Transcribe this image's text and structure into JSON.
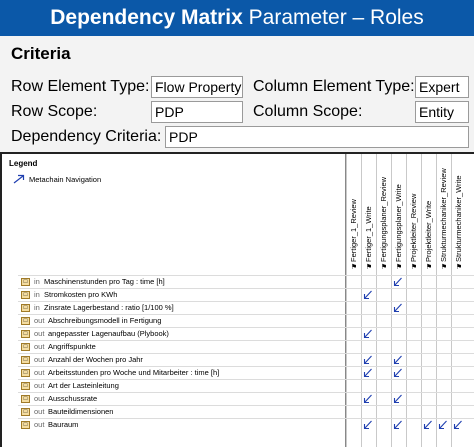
{
  "title": {
    "bold": "Dependency Matrix",
    "rest": " Parameter – Roles"
  },
  "criteria": {
    "heading": "Criteria",
    "row_element_type_label": "Row Element Type:",
    "row_element_type_value": "Flow Property",
    "column_element_type_label": "Column Element Type:",
    "column_element_type_value": "Expert",
    "row_scope_label": "Row Scope:",
    "row_scope_value": "PDP",
    "column_scope_label": "Column Scope:",
    "column_scope_value": "Entity",
    "dependency_criteria_label": "Dependency Criteria:",
    "dependency_criteria_value": "PDP"
  },
  "legend": {
    "title": "Legend",
    "item": "Metachain Navigation"
  },
  "columns": [
    "Fertiger_1_Review",
    "Fertiger_1_Write",
    "Fertigungsplaner_Review",
    "Fertigungsplaner_Write",
    "Projektleiter_Review",
    "Projektleiter_Write",
    "Strukturmechaniker_Review",
    "Strukturmechaniker_Write"
  ],
  "rows": [
    {
      "dir": "in",
      "name": "Maschinenstunden pro Tag : time [h]",
      "marks": [
        3
      ]
    },
    {
      "dir": "in",
      "name": "Stromkosten pro KWh",
      "marks": [
        1
      ]
    },
    {
      "dir": "in",
      "name": "Zinsrate Lagerbestand : ratio [1/100 %]",
      "marks": [
        3
      ]
    },
    {
      "dir": "out",
      "name": "Abschreibungsmodell in Fertigung",
      "marks": []
    },
    {
      "dir": "out",
      "name": "angepasster Lagenaufbau (Plybook)",
      "marks": [
        1
      ]
    },
    {
      "dir": "out",
      "name": "Angriffspunkte",
      "marks": []
    },
    {
      "dir": "out",
      "name": "Anzahl der Wochen pro Jahr",
      "marks": [
        1,
        3
      ]
    },
    {
      "dir": "out",
      "name": "Arbeitsstunden pro Woche und Mitarbeiter : time [h]",
      "marks": [
        1,
        3
      ]
    },
    {
      "dir": "out",
      "name": "Art der Lasteinleitung",
      "marks": []
    },
    {
      "dir": "out",
      "name": "Ausschussrate",
      "marks": [
        1,
        3
      ]
    },
    {
      "dir": "out",
      "name": "Bauteildimensionen",
      "marks": []
    },
    {
      "dir": "out",
      "name": "Bauraum",
      "marks": [
        1,
        3,
        5,
        6,
        7
      ]
    }
  ],
  "colors": {
    "title_bg": "#0b58a8",
    "arrow": "#1f3fb0"
  }
}
